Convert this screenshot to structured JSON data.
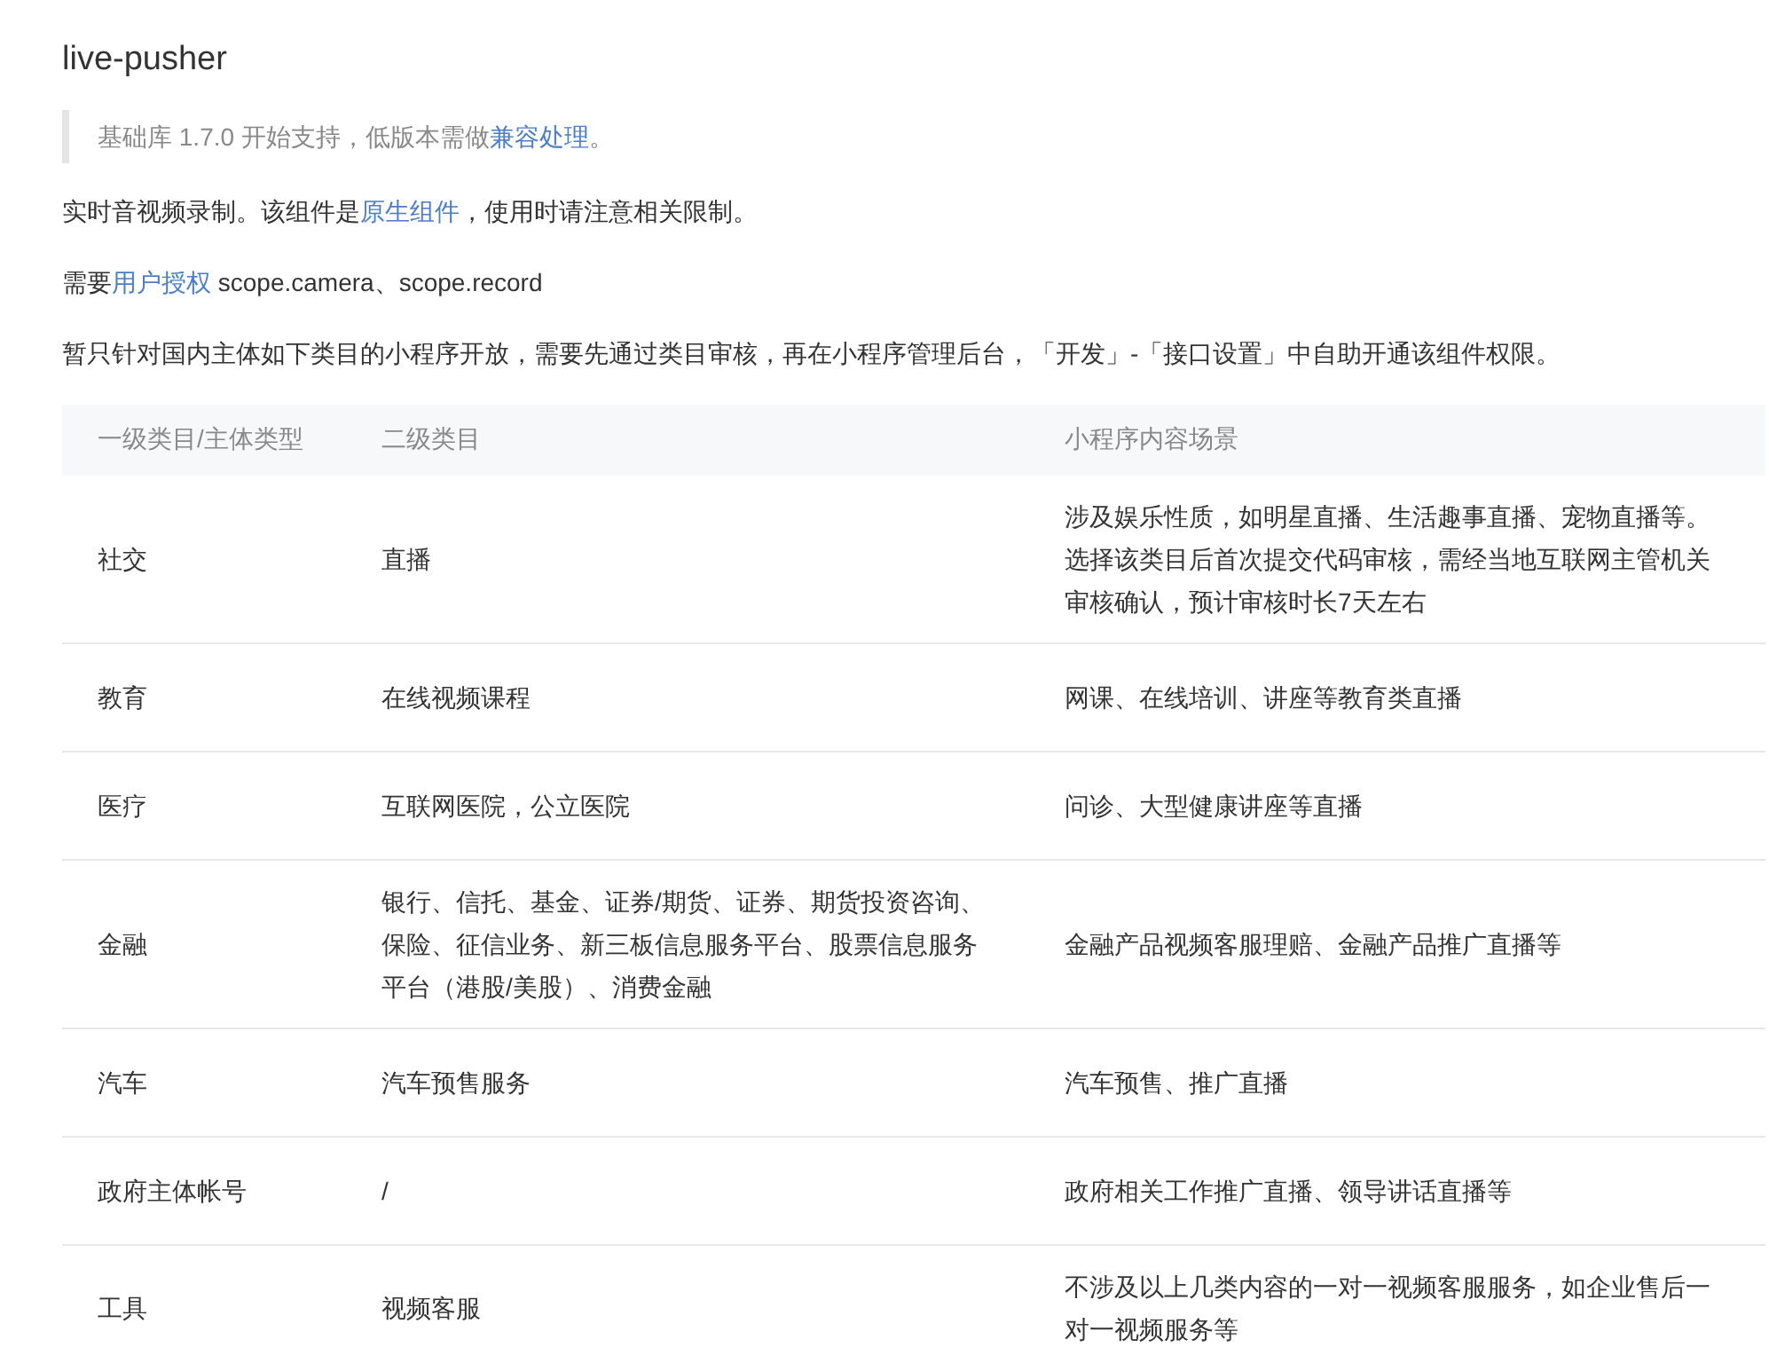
{
  "title": "live-pusher",
  "notice": [
    {
      "kind": "text",
      "text": "基础库 1.7.0 开始支持，低版本需做"
    },
    {
      "kind": "link",
      "text": "兼容处理"
    },
    {
      "kind": "text",
      "text": "。"
    }
  ],
  "paragraphs": [
    [
      {
        "kind": "text",
        "text": "实时音视频录制。该组件是"
      },
      {
        "kind": "link",
        "text": "原生组件"
      },
      {
        "kind": "text",
        "text": "，使用时请注意相关限制。"
      }
    ],
    [
      {
        "kind": "text",
        "text": "需要"
      },
      {
        "kind": "link",
        "text": "用户授权"
      },
      {
        "kind": "text",
        "text": " scope.camera、scope.record"
      }
    ],
    [
      {
        "kind": "text",
        "text": "暂只针对国内主体如下类目的小程序开放，需要先通过类目审核，再在小程序管理后台，「开发」-「接口设置」中自助开通该组件权限。"
      }
    ]
  ],
  "table": {
    "columns": [
      "一级类目/主体类型",
      "二级类目",
      "小程序内容场景"
    ],
    "rows": [
      [
        "社交",
        "直播",
        "涉及娱乐性质，如明星直播、生活趣事直播、宠物直播等。选择该类目后首次提交代码审核，需经当地互联网主管机关审核确认，预计审核时长7天左右"
      ],
      [
        "教育",
        "在线视频课程",
        "网课、在线培训、讲座等教育类直播"
      ],
      [
        "医疗",
        "互联网医院，公立医院",
        "问诊、大型健康讲座等直播"
      ],
      [
        "金融",
        "银行、信托、基金、证券/期货、证券、期货投资咨询、保险、征信业务、新三板信息服务平台、股票信息服务平台（港股/美股）、消费金融",
        "金融产品视频客服理赔、金融产品推广直播等"
      ],
      [
        "汽车",
        "汽车预售服务",
        "汽车预售、推广直播"
      ],
      [
        "政府主体帐号",
        "/",
        "政府相关工作推广直播、领导讲话直播等"
      ],
      [
        "工具",
        "视频客服",
        "不涉及以上几类内容的一对一视频客服服务，如企业售后一对一视频服务等"
      ]
    ]
  }
}
